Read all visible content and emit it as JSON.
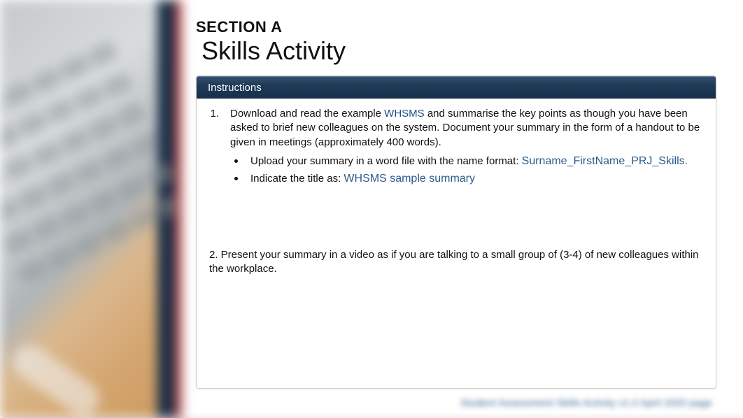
{
  "header": {
    "section_label": "SECTION A",
    "activity_title": "Skills Activity"
  },
  "instructions": {
    "bar_label": "Instructions",
    "item1": {
      "number": "1.",
      "text_before_link": "Download and read the example ",
      "link_text": "WHSMS",
      "text_after_link": " and summarise the key points as though you have been asked to brief new colleagues on the system. Document your summary in the form of a handout to be given in meetings (approximately 400 words).",
      "sub_a_prefix": "Upload your summary in a word file with the name format: ",
      "sub_a_value": "Surname_FirstName_PRJ_Skills.",
      "sub_b_prefix": "Indicate the title as: ",
      "sub_b_value": "WHSMS sample summary"
    },
    "item2": {
      "text": "2. Present your summary in a video as if you are talking to a small group of (3-4) of new colleagues within the workplace."
    }
  },
  "footer": {
    "blur_text": "Student Assessment Skills Activity v1.0 April 2020 page"
  }
}
